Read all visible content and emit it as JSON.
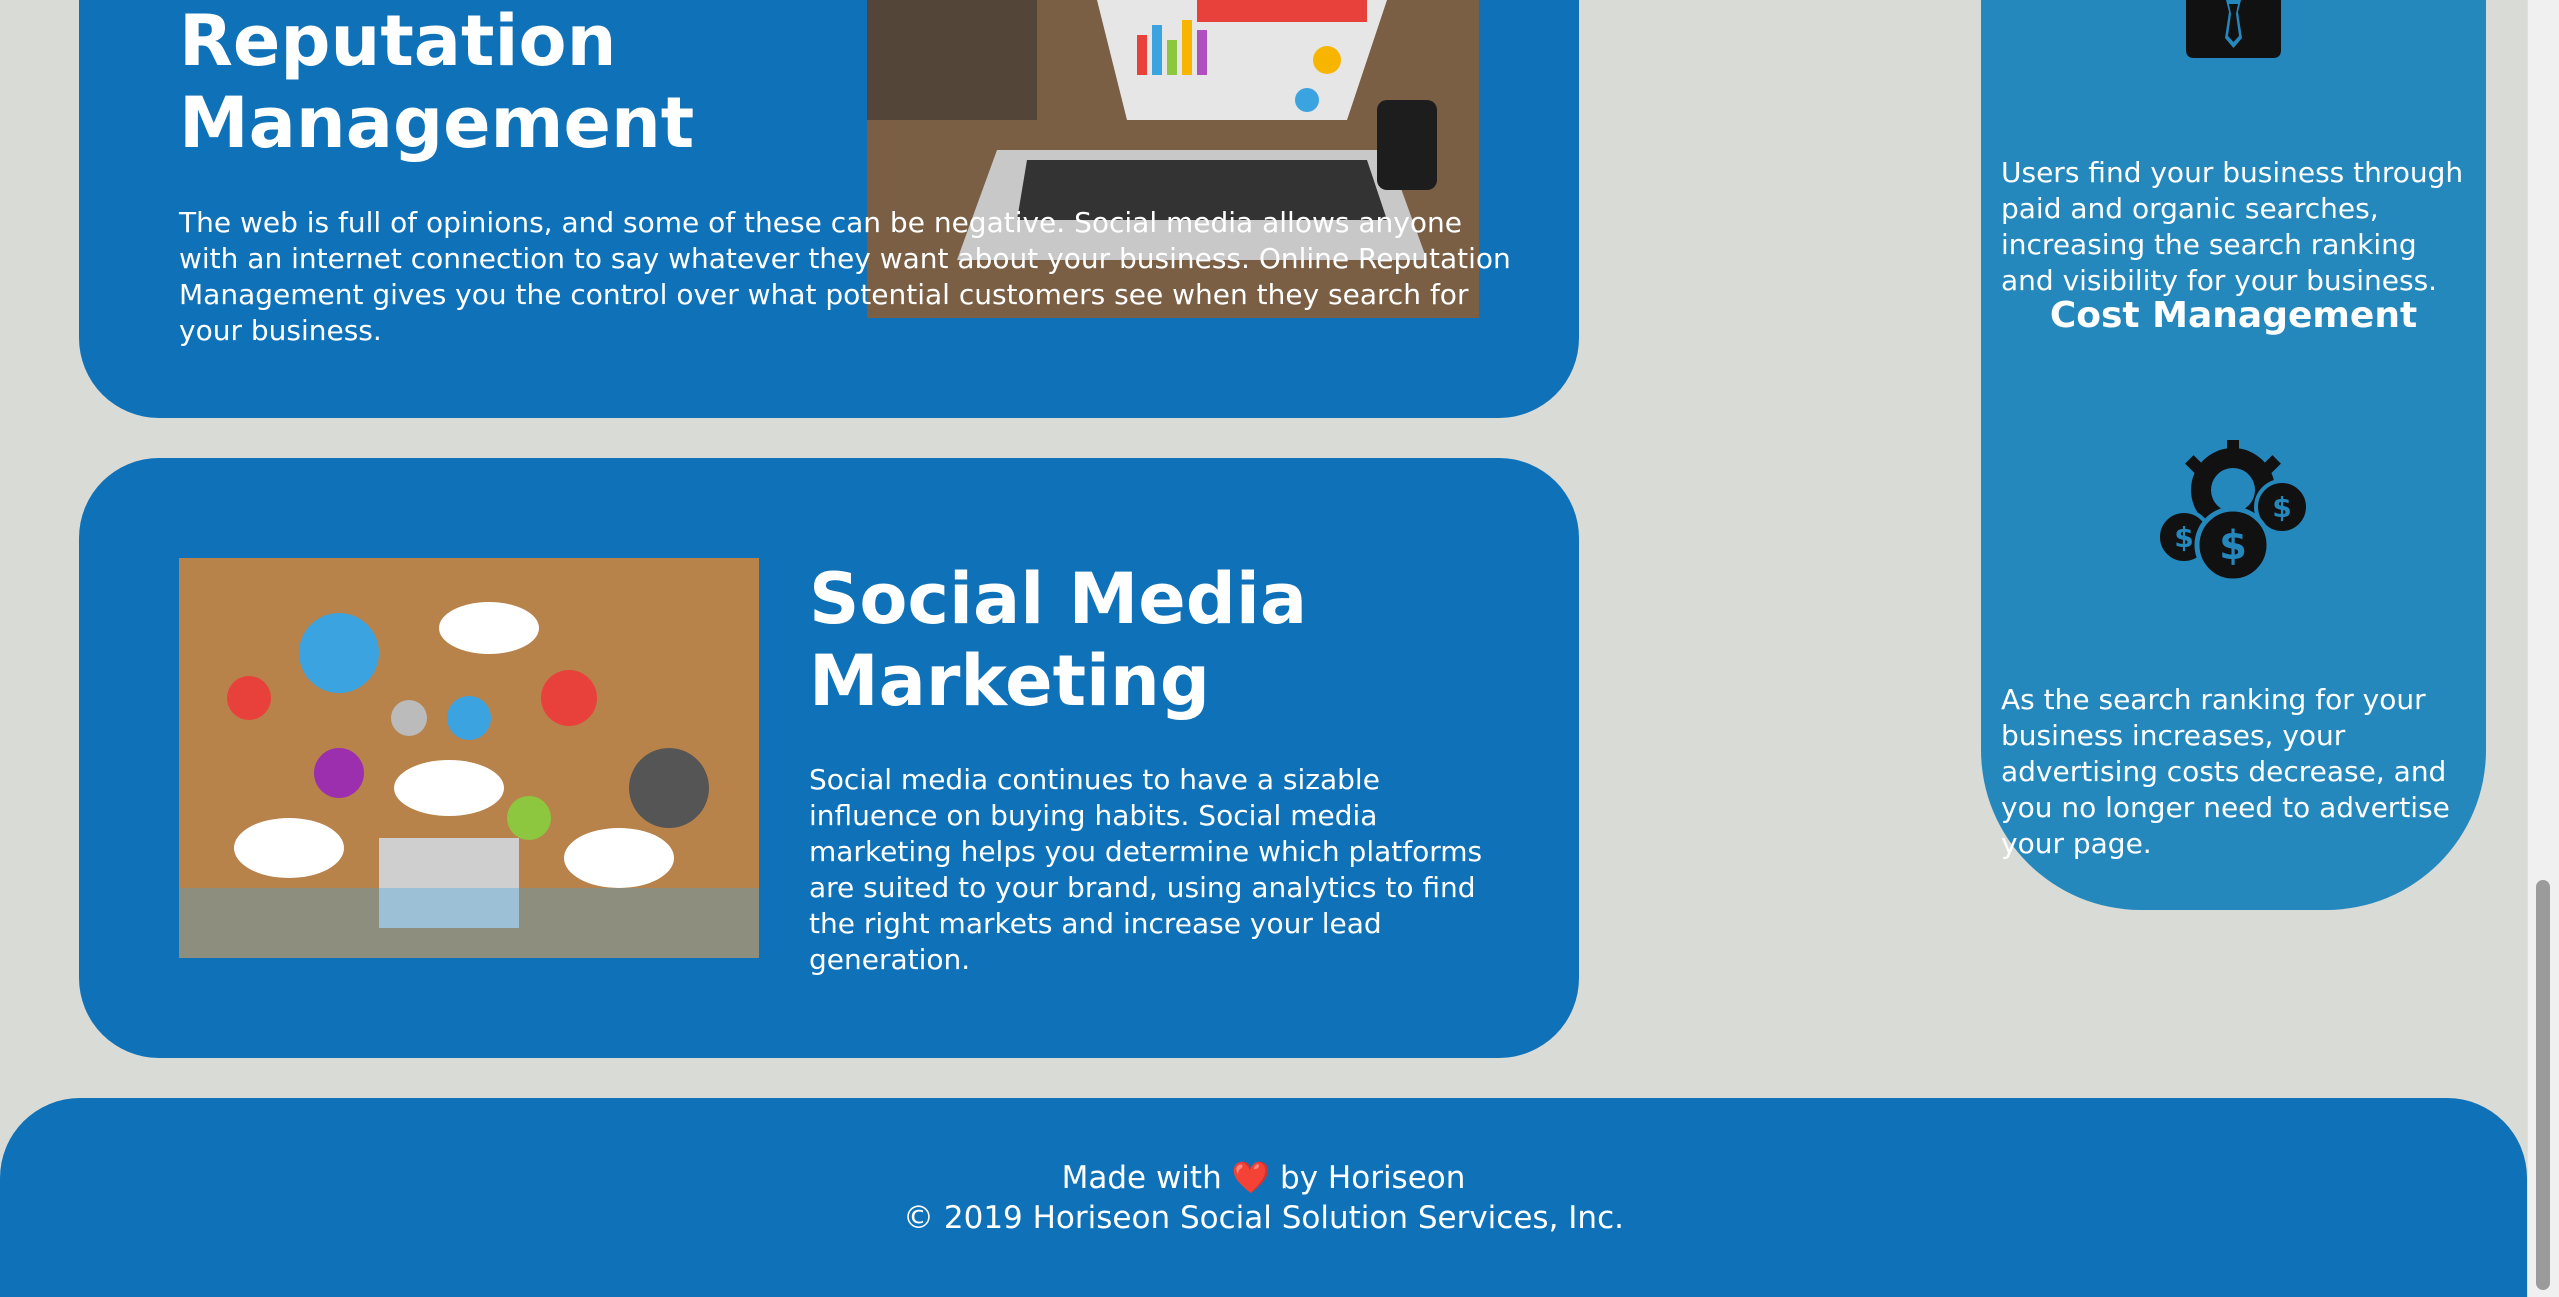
{
  "reputation": {
    "title_line1": "Reputation",
    "title_line2": "Management",
    "description": "The web is full of opinions, and some of these can be negative. Social media allows anyone with an internet connection to say whatever they want about your business. Online Reputation Management gives you the control over what potential customers see when they search for your business."
  },
  "social_media": {
    "title_line1": "Social Media",
    "title_line2": "Marketing",
    "description": "Social media continues to have a sizable influence on buying habits. Social media marketing helps you determine which platforms are suited to your brand, using analytics to find the right markets and increase your lead generation."
  },
  "sidebar": {
    "search_text": "Users find your business through paid and organic searches, increasing the search ranking and visibility for your business.",
    "cost_title": "Cost Management",
    "cost_text": "As the search ranking for your business increases, your advertising costs decrease, and you no longer need to advertise your page."
  },
  "footer": {
    "made_with_prefix": "Made with",
    "heart": "❤️",
    "made_with_suffix": "by Horiseon",
    "copyright": "© 2019 Horiseon Social Solution Services, Inc."
  },
  "icons": {
    "lead_icon": "person-tie-icon",
    "cost_icon": "gear-dollar-icon",
    "heart": "heart-icon"
  },
  "colors": {
    "card_blue": "#0f72b9",
    "sidebar_blue": "#2588bd",
    "page_bg": "#d9dbd7"
  }
}
